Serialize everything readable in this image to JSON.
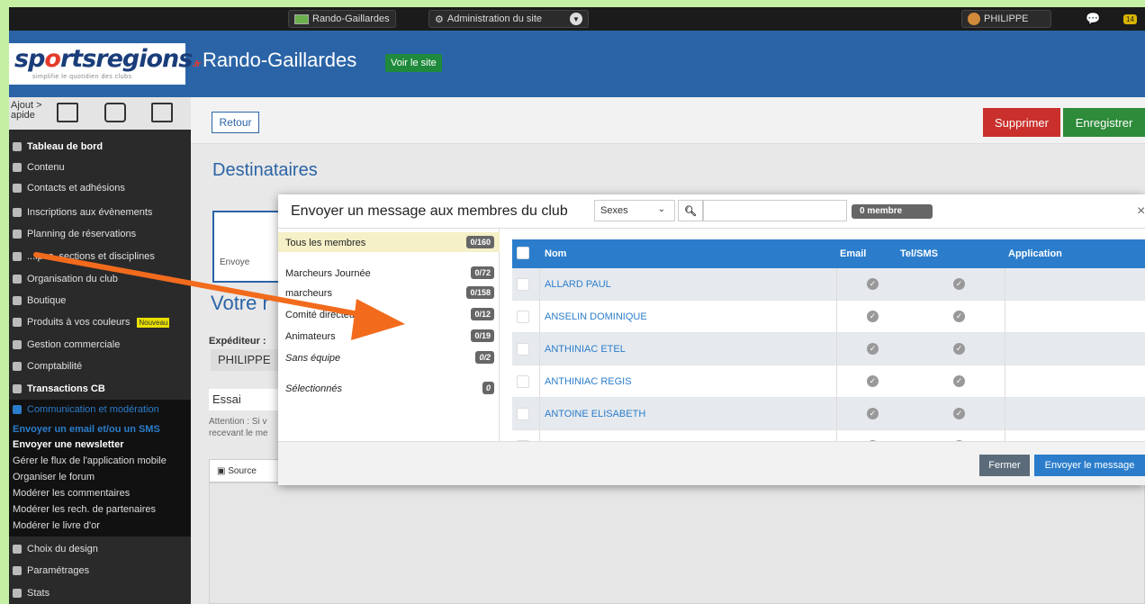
{
  "topbar": {
    "site_name": "Rando-Gaillardes",
    "admin_label": "Administration du site",
    "user_name": "PHILIPPE",
    "notif_count": "14"
  },
  "header": {
    "logo_text_a": "sp",
    "logo_text_o": "o",
    "logo_text_b": "rtsregions",
    "logo_suffix": ".fr",
    "logo_tagline": "simplifie le quotidien des clubs",
    "site_title": "Rando-Gaillardes",
    "voir_site": "Voir le site"
  },
  "sidebar": {
    "quickadd_line1": "Ajout >",
    "quickadd_line2": "apide",
    "items": [
      {
        "label": "Tableau de bord",
        "bold": true
      },
      {
        "label": "Contenu"
      },
      {
        "label": "Contacts et adhésions"
      },
      {
        "label": "Inscriptions aux évènements"
      },
      {
        "label": "Planning de réservations"
      },
      {
        "label": "...ipes, sections et disciplines"
      },
      {
        "label": "Organisation du club"
      },
      {
        "label": "Boutique"
      },
      {
        "label": "Produits à vos couleurs"
      },
      {
        "label": "Gestion commerciale"
      },
      {
        "label": "Comptabilité"
      },
      {
        "label": "Transactions CB",
        "bold": true
      },
      {
        "label": "Communication et modération"
      }
    ],
    "new_badge": "Nouveau",
    "submenu": [
      "Envoyer un email et/ou un SMS",
      "Envoyer une newsletter",
      "Gérer le flux de l'application mobile",
      "Organiser le forum",
      "Modérer les commentaires",
      "Modérer les rech. de partenaires",
      "Modérer le livre d'or"
    ],
    "bottom_items": [
      "Choix du design",
      "Paramétrages",
      "Stats"
    ]
  },
  "toolbar": {
    "retour": "Retour",
    "supprimer": "Supprimer",
    "enregistrer": "Enregistrer"
  },
  "main": {
    "section_title": "Destinataires",
    "card_label": "Envoye",
    "votre": "Votre r",
    "expediteur": "Expéditeur :",
    "expediteur_value": "PHILIPPE",
    "subject_value": "Essai",
    "attention_line1": "Attention : Si v",
    "attention_line2": "recevant le me",
    "source_label": "Source"
  },
  "modal": {
    "title": "Envoyer un message aux membres du club",
    "filter_select": "Sexes",
    "search_placeholder": "",
    "member_count": "0 membre",
    "close": "×",
    "groups": [
      {
        "label": "Tous les membres",
        "count": "0/160",
        "active": true
      },
      {
        "label": "Marcheurs Journée",
        "count": "0/72"
      },
      {
        "label": "marcheurs",
        "count": "0/158"
      },
      {
        "label": "Comité directeur",
        "count": "0/12"
      },
      {
        "label": "Animateurs",
        "count": "0/19"
      },
      {
        "label": "Sans équipe",
        "count": "0/2",
        "italic": true
      },
      {
        "label": "Sélectionnés",
        "count": "0",
        "italic": true
      }
    ],
    "columns": {
      "name": "Nom",
      "email": "Email",
      "sms": "Tel/SMS",
      "app": "Application"
    },
    "rows": [
      {
        "name": "ALLARD PAUL"
      },
      {
        "name": "ANSELIN DOMINIQUE"
      },
      {
        "name": "ANTHINIAC ETEL"
      },
      {
        "name": "ANTHINIAC REGIS"
      },
      {
        "name": "ANTOINE ELISABETH"
      },
      {
        "name": ""
      }
    ],
    "fermer": "Fermer",
    "envoyer": "Envoyer le message"
  },
  "colors": {
    "brand_blue": "#2b64a6",
    "table_blue": "#2b7dcb",
    "danger": "#c9302c",
    "success": "#2e8b3a",
    "arrow": "#f26b1d",
    "background": "#c5f0a4"
  },
  "icons": [
    "cog-icon",
    "chevron-down-icon",
    "search-icon",
    "check-icon",
    "close-icon",
    "chat-icon",
    "calendar-icon",
    "image-icon",
    "arrow-annotation"
  ]
}
